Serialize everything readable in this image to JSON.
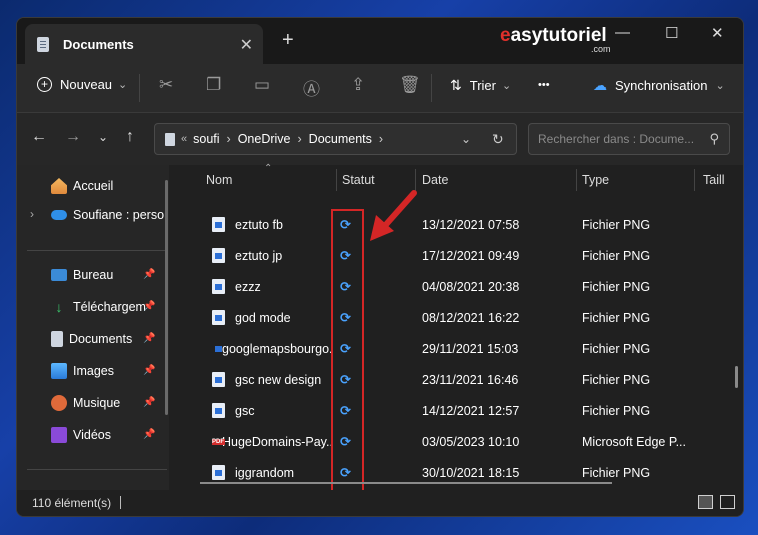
{
  "window": {
    "tab_title": "Documents",
    "tab_close": "✕",
    "new_tab": "+",
    "brand_e": "e",
    "brand_name": "asytutoriel",
    "brand_com": ".com",
    "minimize": "—",
    "maximize": "☐",
    "close": "✕"
  },
  "toolbar": {
    "new_label": "Nouveau",
    "sort_label": "Trier",
    "more_label": "•••",
    "sync_label": "Synchronisation",
    "chevron": "⌄"
  },
  "address": {
    "path": [
      "soufi",
      "OneDrive",
      "Documents"
    ],
    "overflow": "«",
    "search_placeholder": "Rechercher dans : Docume..."
  },
  "sidebar": {
    "items": [
      {
        "label": "Accueil",
        "icon": "home-icon",
        "pinned": false
      },
      {
        "label": "Soufiane : perso",
        "icon": "onedrive-icon",
        "pinned": false
      },
      {
        "label": "Bureau",
        "icon": "desktop-icon",
        "pinned": true
      },
      {
        "label": "Téléchargem",
        "icon": "download-icon",
        "pinned": true
      },
      {
        "label": "Documents",
        "icon": "documents-icon",
        "pinned": true
      },
      {
        "label": "Images",
        "icon": "images-icon",
        "pinned": true
      },
      {
        "label": "Musique",
        "icon": "music-icon",
        "pinned": true
      },
      {
        "label": "Vidéos",
        "icon": "videos-icon",
        "pinned": true
      }
    ]
  },
  "columns": {
    "name": "Nom",
    "status": "Statut",
    "date": "Date",
    "type": "Type",
    "size": "Taill"
  },
  "files": [
    {
      "name": "eztuto fb",
      "date": "13/12/2021 07:58",
      "type": "Fichier PNG",
      "icon": "png"
    },
    {
      "name": "eztuto jp",
      "date": "17/12/2021 09:49",
      "type": "Fichier PNG",
      "icon": "png"
    },
    {
      "name": "ezzz",
      "date": "04/08/2021 20:38",
      "type": "Fichier PNG",
      "icon": "png"
    },
    {
      "name": "god mode",
      "date": "08/12/2021 16:22",
      "type": "Fichier PNG",
      "icon": "png"
    },
    {
      "name": "googlemapsbourgo...",
      "date": "29/11/2021 15:03",
      "type": "Fichier PNG",
      "icon": "png"
    },
    {
      "name": "gsc new design",
      "date": "23/11/2021 16:46",
      "type": "Fichier PNG",
      "icon": "png"
    },
    {
      "name": "gsc",
      "date": "14/12/2021 12:57",
      "type": "Fichier PNG",
      "icon": "png"
    },
    {
      "name": "HugeDomains-Pay...",
      "date": "03/05/2023 10:10",
      "type": "Microsoft Edge P...",
      "icon": "pdf"
    },
    {
      "name": "iggrandom",
      "date": "30/10/2021 18:15",
      "type": "Fichier PNG",
      "icon": "png"
    }
  ],
  "status_bar": {
    "count": "110 élément(s)"
  },
  "colors": {
    "accent": "#4aa3ff",
    "highlight": "#d42626"
  }
}
